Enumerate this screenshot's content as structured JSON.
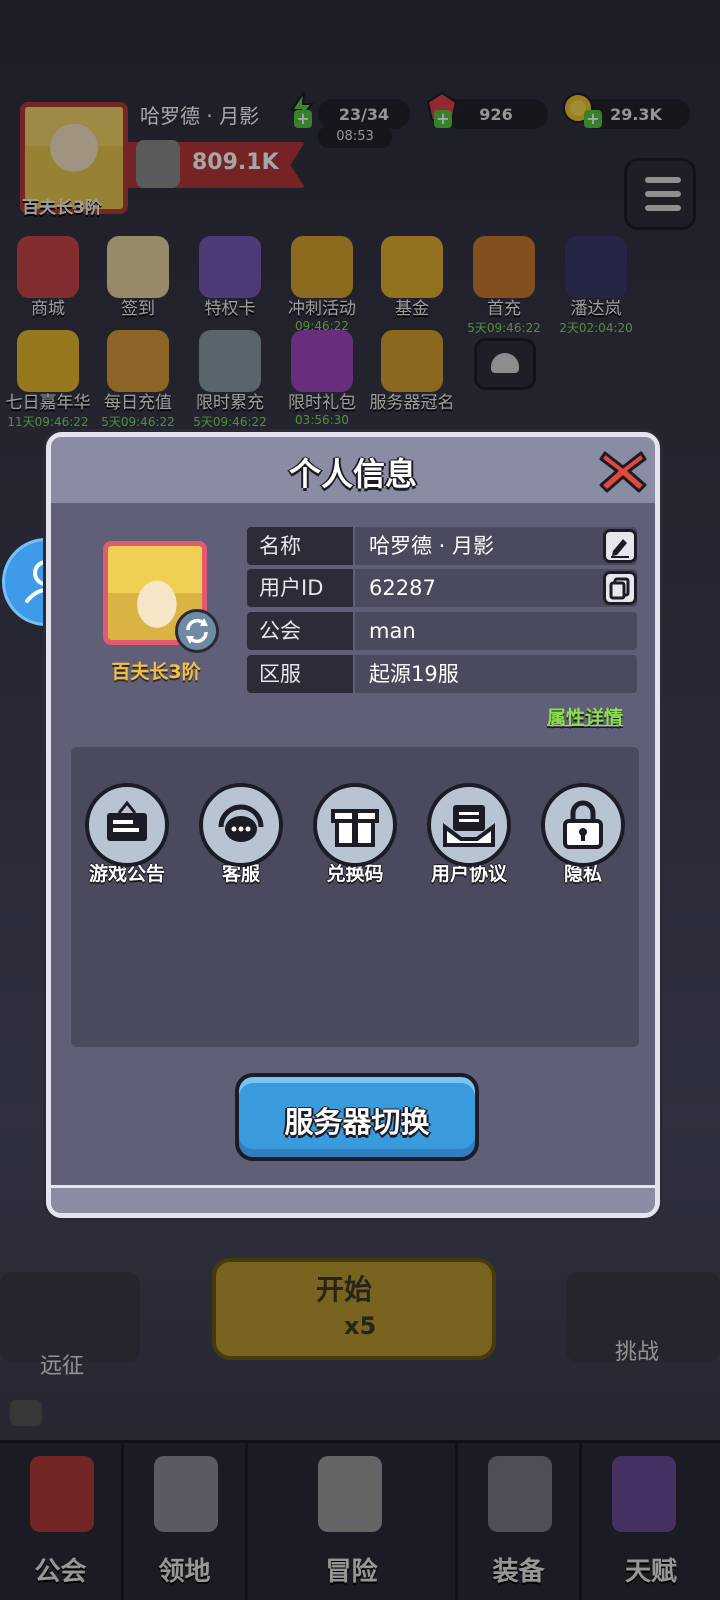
{
  "hud": {
    "player_name": "哈罗德 · 月影",
    "rank": "百夫长3阶",
    "stamina": "23/34",
    "stamina_timer": "08:53",
    "gems": "926",
    "gold": "29.3K",
    "power": "809.1K"
  },
  "features_row1": [
    {
      "label": "商城",
      "timer": ""
    },
    {
      "label": "签到",
      "timer": ""
    },
    {
      "label": "特权卡",
      "timer": ""
    },
    {
      "label": "冲刺活动",
      "timer": "09:46:22"
    },
    {
      "label": "基金",
      "timer": ""
    },
    {
      "label": "首充",
      "timer": "5天09:46:22"
    },
    {
      "label": "潘达岚",
      "timer": "2天02:04:20"
    }
  ],
  "features_row2": [
    {
      "label": "七日嘉年华",
      "timer": "11天09:46:22"
    },
    {
      "label": "每日充值",
      "timer": "5天09:46:22"
    },
    {
      "label": "限时累充",
      "timer": "5天09:46:22"
    },
    {
      "label": "限时礼包",
      "timer": "03:56:30"
    },
    {
      "label": "服务器冠名",
      "timer": ""
    }
  ],
  "game": {
    "expedition": "远征",
    "start": "开始",
    "start_cost": "x5",
    "challenge": "挑战"
  },
  "nav": [
    {
      "label": "公会"
    },
    {
      "label": "领地"
    },
    {
      "label": "冒险"
    },
    {
      "label": "装备"
    },
    {
      "label": "天赋"
    }
  ],
  "modal": {
    "title": "个人信息",
    "rank": "百夫长3阶",
    "rows": [
      {
        "key": "名称",
        "value": "哈罗德 · 月影"
      },
      {
        "key": "用户ID",
        "value": "62287"
      },
      {
        "key": "公会",
        "value": "man"
      },
      {
        "key": "区服",
        "value": "起源19服"
      }
    ],
    "attr_link": "属性详情",
    "functions": [
      {
        "label": "游戏公告",
        "icon": "notice-board-icon"
      },
      {
        "label": "客服",
        "icon": "headset-icon"
      },
      {
        "label": "兑换码",
        "icon": "gift-icon"
      },
      {
        "label": "用户协议",
        "icon": "agreement-icon"
      },
      {
        "label": "隐私",
        "icon": "lock-icon"
      }
    ],
    "switch_server": "服务器切换"
  },
  "colors": {
    "accent_blue": "#3a9bdc",
    "rank_gold": "#f5c03e",
    "link_green": "#8ee04a",
    "close_red": "#e04a3a"
  }
}
